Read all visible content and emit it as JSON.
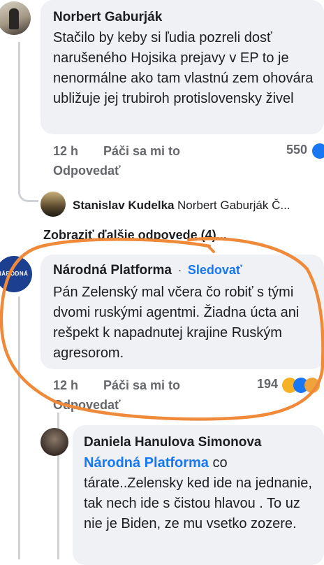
{
  "comments": {
    "c1": {
      "author": "Norbert Gaburják",
      "text": "Stačilo by keby si ľudia pozreli dosť narušeného Hojsika prejavy v EP to je nenormálne ako tam vlastnú zem ohovára ubližuje jej trubiroh protislovensky živel",
      "time": "12 h",
      "like": "Páči sa mi to",
      "reply": "Odpovedať",
      "reactions": "550"
    },
    "reply_preview": {
      "author": "Stanislav Kudelka",
      "mention": "Norbert Gaburják Č..."
    },
    "more_replies": "Zobraziť ďalšie odpovede (4)...",
    "c2": {
      "author": "Národná Platforma",
      "dot": "·",
      "follow": "Sledovať",
      "avatar_text": "NÁRODNÁ",
      "text": "Pán Zelenský mal včera čo robiť s tými dvomi ruskými agentmi. Žiadna úcta ani rešpekt k napadnutej krajine Ruským agresorom.",
      "time": "12 h",
      "like": "Páči sa mi to",
      "reply": "Odpovedať",
      "reactions": "194"
    },
    "c3": {
      "author": "Daniela Hanulova Simonova",
      "mention": "Národná Platforma",
      "text": "co tárate..Zelensky ked ide na jednanie, tak nech ide s čistou hlavou . To uz nie je Biden, ze mu vsetko zozere."
    }
  },
  "colors": {
    "accent_blue": "#1877f2",
    "bubble": "#eff1f4",
    "annotation_orange": "#ef8a3a",
    "meta_gray": "#65676b"
  }
}
